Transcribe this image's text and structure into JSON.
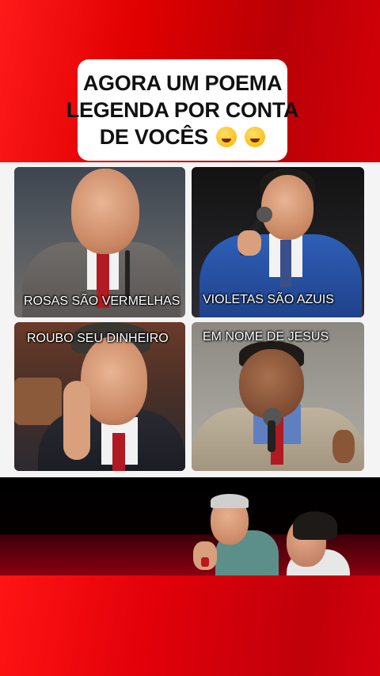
{
  "title": {
    "line1": "AGORA UM POEMA",
    "line2": "LEGENDA POR CONTA",
    "line3": "DE VOCÊS",
    "emojis": [
      "winking-tongue-emoji",
      "rofl-emoji"
    ]
  },
  "collage": {
    "panels": [
      {
        "caption": "ROSAS SÃO VERMELHAS"
      },
      {
        "caption": "VIOLETAS SÃO AZUIS"
      },
      {
        "caption": "ROUBO SEU DINHEIRO"
      },
      {
        "caption": "EM NOME DE JESUS"
      }
    ]
  },
  "colors": {
    "background_red": "#d3000a",
    "title_box": "#ffffff",
    "caption_text": "#ffffff"
  }
}
